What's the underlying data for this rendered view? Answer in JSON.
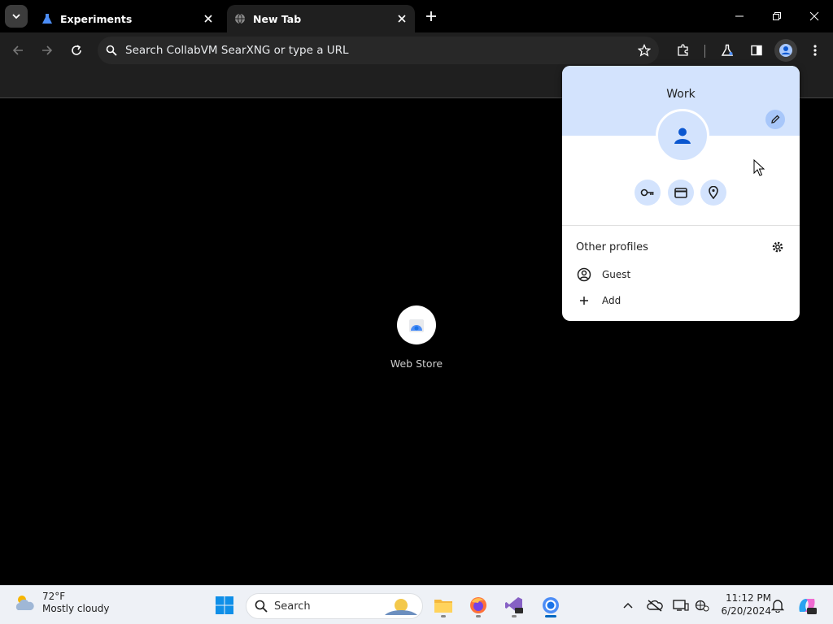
{
  "browser": {
    "tabs": [
      {
        "title": "Experiments",
        "active": false
      },
      {
        "title": "New Tab",
        "active": true
      }
    ],
    "omnibox": {
      "placeholder": "Search CollabVM SearXNG or type a URL"
    }
  },
  "new_tab_page": {
    "shortcuts": [
      {
        "label": "Web Store"
      }
    ]
  },
  "profile_menu": {
    "profile_name": "Work",
    "other_profiles_heading": "Other profiles",
    "items": [
      {
        "label": "Guest",
        "icon": "account-circle-icon"
      },
      {
        "label": "Add",
        "icon": "plus-icon"
      }
    ],
    "quick_actions": [
      "key-icon",
      "credit-card-icon",
      "location-pin-icon"
    ]
  },
  "taskbar": {
    "weather": {
      "temp": "72°F",
      "condition": "Mostly cloudy"
    },
    "search_label": "Search",
    "clock": {
      "time": "11:12 PM",
      "date": "6/20/2024"
    }
  },
  "colors": {
    "accent_blue": "#0b57d0",
    "menu_banner": "#d3e3fd",
    "toolbar": "#1f1f1f"
  }
}
